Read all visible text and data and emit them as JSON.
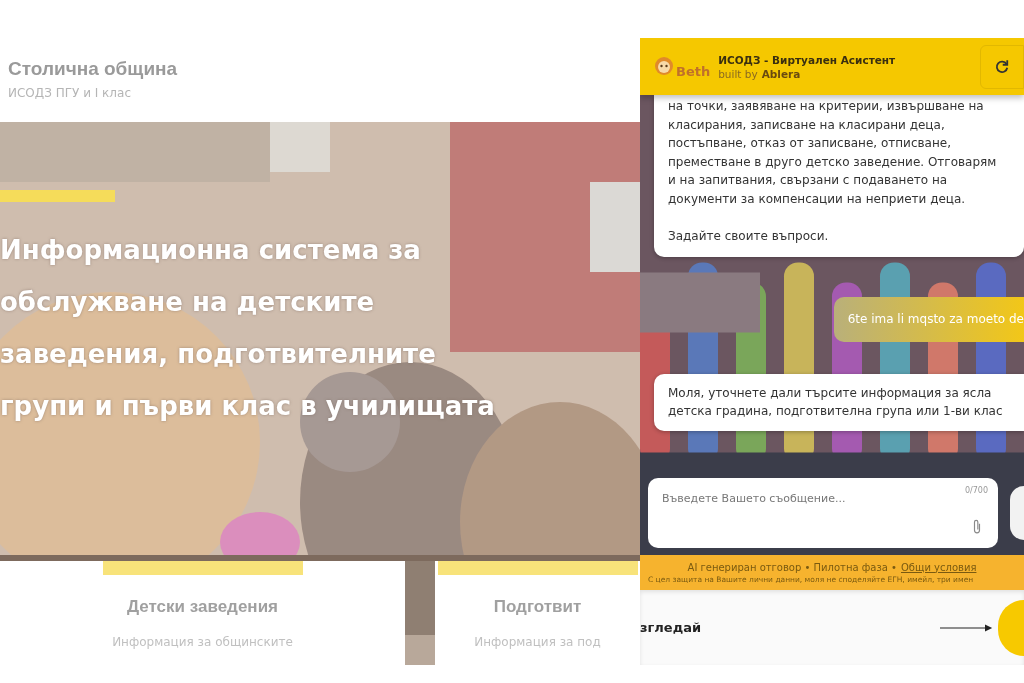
{
  "site": {
    "title": "Столична община",
    "subtitle": "ИСОДЗ ПГУ и I клас"
  },
  "hero": {
    "heading_lines": [
      "Информационна система за",
      "обслужване на детските",
      "заведения, подготвителните",
      "групи и първи клас в училищата"
    ]
  },
  "cards": [
    {
      "title": "Детски заведения",
      "text": "Информация за общинските"
    },
    {
      "title": "Подготвит",
      "text": "Информация за под"
    }
  ],
  "chat": {
    "logo": "Beth",
    "title": "ИСОДЗ - Виртуален Асистент",
    "built_by": "built by",
    "brand": "Ablera",
    "messages": [
      {
        "kind": "bot",
        "paragraphs": [
          [
            "на точки, заявяване на критерии, извършване на",
            "класирания, записване на класирани деца,",
            "постъпване, отказ от записване, отписване,",
            "преместване в друго детско заведение. Отговарям",
            "и на запитвания, свързани с подаването на",
            "документи за компенсации на неприети деца."
          ],
          [
            "Задайте своите въпроси."
          ]
        ]
      },
      {
        "kind": "user",
        "paragraphs": [
          [
            "6te ima li mqsto za moeto de"
          ]
        ]
      },
      {
        "kind": "bot",
        "paragraphs": [
          [
            "Моля, уточнете дали търсите информация за ясла",
            "детска градина, подготвителна група или 1-ви клас"
          ]
        ]
      }
    ],
    "input": {
      "placeholder": "Въведете Вашето съобщение...",
      "counter": "0/700"
    },
    "notice": "AI генериран отговор • Пилотна фаза •",
    "terms_link": "Общи условия",
    "privacy": "С цел защита на Вашите лични данни, моля не споделяйте ЕГН, имейл, три имен"
  },
  "browse": {
    "label": "згледай"
  }
}
